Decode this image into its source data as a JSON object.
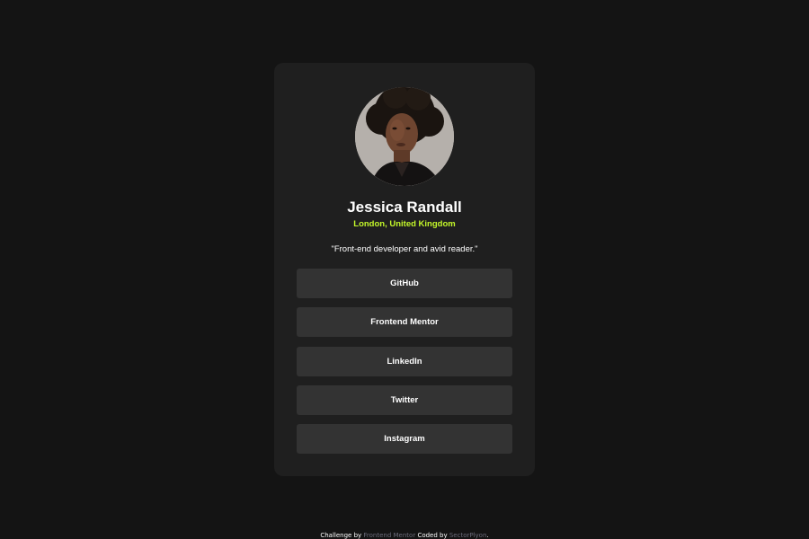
{
  "profile": {
    "name": "Jessica Randall",
    "location": "London, United Kingdom",
    "bio": "\"Front-end developer and avid reader.\""
  },
  "links": [
    {
      "label": "GitHub"
    },
    {
      "label": "Frontend Mentor"
    },
    {
      "label": "LinkedIn"
    },
    {
      "label": "Twitter"
    },
    {
      "label": "Instagram"
    }
  ],
  "footer": {
    "prefix": "Challenge by",
    "challenge_link": "Frontend Mentor",
    "middle": "Coded by",
    "author_link": "SectorPlyon",
    "suffix": "."
  },
  "colors": {
    "page_background": "#141414",
    "card_background": "#1f1f1f",
    "button_background": "#333333",
    "accent": "#c4f82a",
    "text": "#ffffff"
  }
}
